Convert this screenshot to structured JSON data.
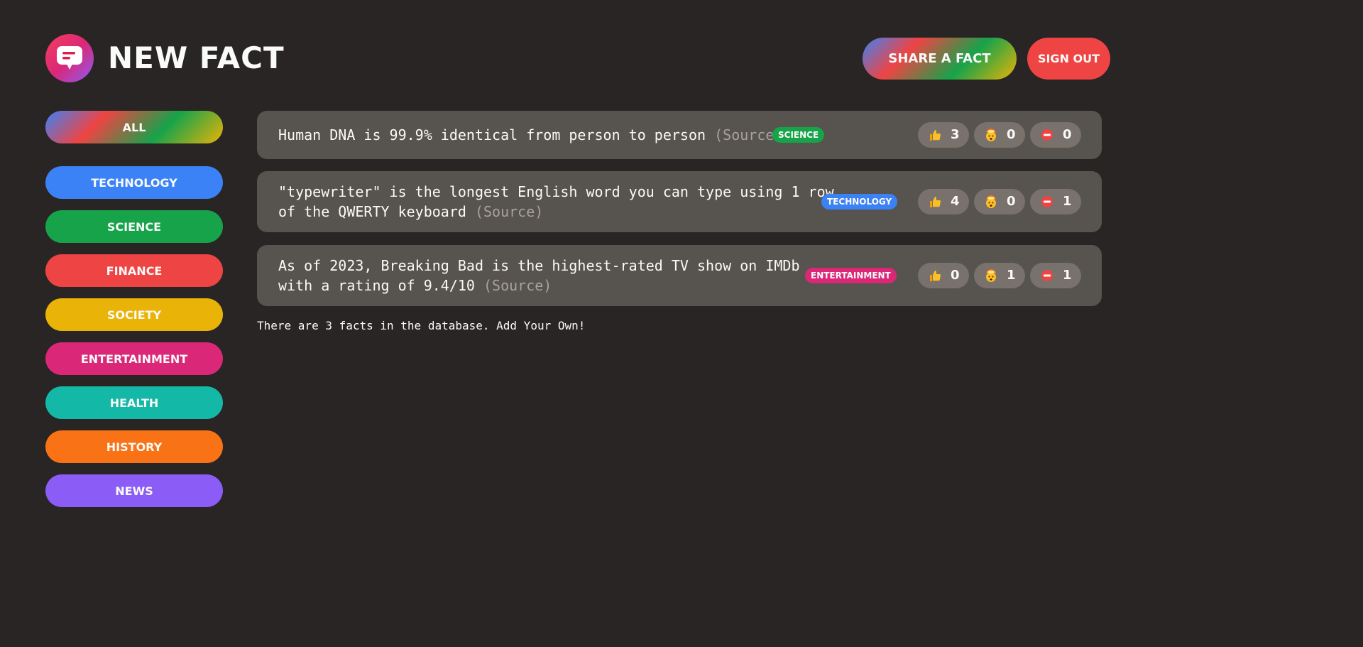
{
  "header": {
    "title": "NEW FACT",
    "share_label": "SHARE A FACT",
    "signout_label": "SIGN OUT"
  },
  "sidebar": {
    "all_label": "ALL",
    "categories": [
      {
        "label": "TECHNOLOGY",
        "color": "#3b82f6"
      },
      {
        "label": "SCIENCE",
        "color": "#16a34a"
      },
      {
        "label": "FINANCE",
        "color": "#ef4444"
      },
      {
        "label": "SOCIETY",
        "color": "#eab308"
      },
      {
        "label": "ENTERTAINMENT",
        "color": "#db2777"
      },
      {
        "label": "HEALTH",
        "color": "#14b8a6"
      },
      {
        "label": "HISTORY",
        "color": "#f97316"
      },
      {
        "label": "NEWS",
        "color": "#8b5cf6"
      }
    ]
  },
  "facts": [
    {
      "text": "Human DNA is 99.9% identical from person to person",
      "source_label": "(Source)",
      "category": "SCIENCE",
      "category_color": "#16a34a",
      "votes_interesting": "3",
      "votes_mindblowing": "0",
      "votes_false": "0"
    },
    {
      "text_line1": "\"typewriter\" is the longest English word you can type using 1 row",
      "text_line2": "of the QWERTY keyboard",
      "source_label": "(Source)",
      "category": "TECHNOLOGY",
      "category_color": "#3b82f6",
      "votes_interesting": "4",
      "votes_mindblowing": "0",
      "votes_false": "1"
    },
    {
      "text_line1": "As of 2023, Breaking Bad is the highest-rated TV show on IMDb",
      "text_line2": "with a rating of 9.4/10",
      "source_label": "(Source)",
      "category": "ENTERTAINMENT",
      "category_color": "#db2777",
      "votes_interesting": "0",
      "votes_mindblowing": "1",
      "votes_false": "1"
    }
  ],
  "footer": {
    "text": "There are 3 facts in the database. Add Your Own!"
  },
  "colors": {
    "background": "#292524",
    "card": "#57534e",
    "vote_button": "#78716c"
  },
  "icons": {
    "logo": "speech-bubble-icon",
    "interesting": "thumbs-up-icon",
    "mindblowing": "mind-blown-icon",
    "false": "no-entry-icon"
  }
}
